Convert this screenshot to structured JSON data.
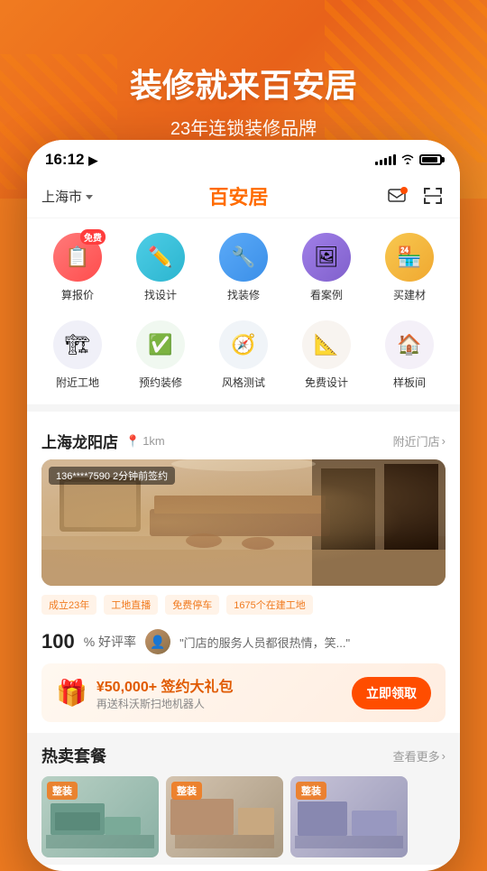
{
  "background": {
    "title": "装修就来百安居",
    "subtitle": "23年连锁装修品牌",
    "color": "#F07B20"
  },
  "statusBar": {
    "time": "16:12",
    "navigation": "▶"
  },
  "appHeader": {
    "location": "上海市",
    "logo": "百安居",
    "msg_icon": "message",
    "scan_icon": "scan"
  },
  "quickAccess": {
    "row1": [
      {
        "id": "estimate",
        "label": "算报价",
        "badge": "免费",
        "color": "#FF6B6B",
        "emoji": "🗒"
      },
      {
        "id": "design",
        "label": "找设计",
        "badge": "",
        "color": "#4ECDE6",
        "emoji": "✏️"
      },
      {
        "id": "renovation",
        "label": "找装修",
        "badge": "",
        "color": "#3B8FE8",
        "emoji": "🔧"
      },
      {
        "id": "cases",
        "label": "看案例",
        "badge": "",
        "color": "#8B7FE8",
        "emoji": "🖼"
      },
      {
        "id": "materials",
        "label": "买建材",
        "badge": "",
        "color": "#F0A830",
        "emoji": "🏪"
      }
    ],
    "row2": [
      {
        "id": "nearby",
        "label": "附近工地",
        "badge": "",
        "color": "#E8E8F0",
        "emoji": "🏗"
      },
      {
        "id": "booking",
        "label": "预约装修",
        "badge": "",
        "color": "#E8F0E8",
        "emoji": "✅"
      },
      {
        "id": "style_test",
        "label": "风格测试",
        "badge": "",
        "color": "#E8F0F8",
        "emoji": "🧭"
      },
      {
        "id": "free_design",
        "label": "免费设计",
        "badge": "",
        "color": "#F8F0E8",
        "emoji": "📋"
      },
      {
        "id": "showroom",
        "label": "样板间",
        "badge": "",
        "color": "#F0E8F0",
        "emoji": "🏠"
      }
    ]
  },
  "storeCard": {
    "name": "上海龙阳店",
    "distance_icon": "📍",
    "distance": "1km",
    "nearby_link": "附近门店",
    "phone_tag": "136****7590  2分钟前签约",
    "features": [
      "成立23年",
      "工地直播",
      "免费停车",
      "1675个在建工地"
    ],
    "rating_number": "100",
    "rating_label": "% 好评率",
    "avatar_text": "👤",
    "comment": "\"门店的服务人员都很热情，笑...\"",
    "promo_amount": "¥50,000+ 签约大礼包",
    "promo_desc": "再送科沃斯扫地机器人",
    "promo_btn": "立即领取"
  },
  "hotSection": {
    "title": "热卖套餐",
    "more": "查看更多",
    "cards": [
      {
        "label": "整装",
        "bg": "1"
      },
      {
        "label": "整装",
        "bg": "2"
      },
      {
        "label": "整装",
        "bg": "3"
      }
    ]
  }
}
